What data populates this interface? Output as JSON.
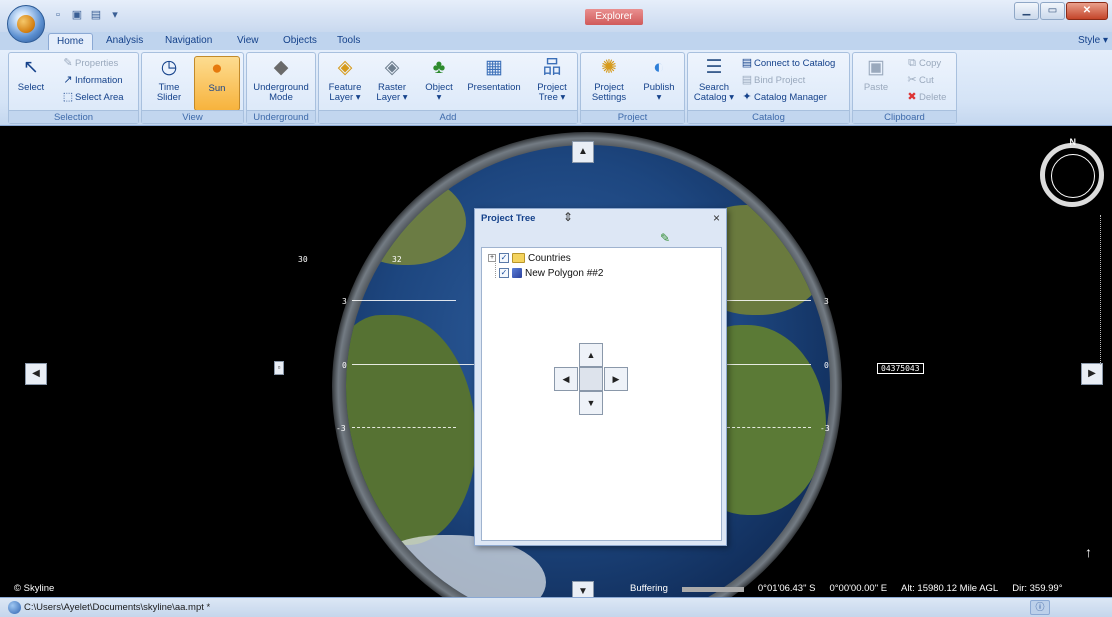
{
  "window": {
    "title": "Explorer",
    "controls": [
      "▁",
      "▭",
      "✕"
    ]
  },
  "ribbon": {
    "tabs": [
      "Home",
      "Analysis",
      "Navigation",
      "View",
      "Objects",
      "Tools"
    ],
    "active_tab": "Home",
    "style_menu": "Style",
    "groups": {
      "selection": {
        "label": "Selection",
        "select": "Select",
        "properties": "Properties",
        "information": "Information",
        "select_area": "Select Area"
      },
      "view": {
        "label": "View",
        "time_slider_1": "Time",
        "time_slider_2": "Slider",
        "sun": "Sun"
      },
      "underground": {
        "label": "Underground",
        "mode_1": "Underground",
        "mode_2": "Mode"
      },
      "add": {
        "label": "Add",
        "feature_layer_1": "Feature",
        "feature_layer_2": "Layer",
        "raster_layer_1": "Raster",
        "raster_layer_2": "Layer",
        "object": "Object",
        "presentation": "Presentation",
        "project_tree_1": "Project",
        "project_tree_2": "Tree"
      },
      "project": {
        "label": "Project",
        "settings_1": "Project",
        "settings_2": "Settings",
        "publish": "Publish"
      },
      "catalog": {
        "label": "Catalog",
        "search_1": "Search",
        "search_2": "Catalog",
        "connect": "Connect to Catalog",
        "bind": "Bind Project",
        "manager": "Catalog Manager"
      },
      "clipboard": {
        "label": "Clipboard",
        "paste": "Paste",
        "copy": "Copy",
        "cut": "Cut",
        "delete": "Delete"
      }
    }
  },
  "viewport": {
    "left_labels": [
      "30",
      "32",
      "3",
      "0",
      "-3"
    ],
    "right_labels": [
      "3",
      "0",
      "-3"
    ],
    "readout": "04375043",
    "credit": "© Skyline",
    "compass_label": "N",
    "status": {
      "buffering": "Buffering",
      "lat": "0°01'06.43\" S",
      "lon": "0°00'00.00\" E",
      "alt": "Alt: 15980.12 Mile AGL",
      "dir": "Dir: 359.99°"
    }
  },
  "project_tree": {
    "title": "Project Tree",
    "items": [
      {
        "label": "Countries"
      },
      {
        "label": "New Polygon ##2"
      }
    ]
  },
  "statusbar": {
    "path": "C:\\Users\\Ayelet\\Documents\\skyline\\aa.mpt *"
  }
}
